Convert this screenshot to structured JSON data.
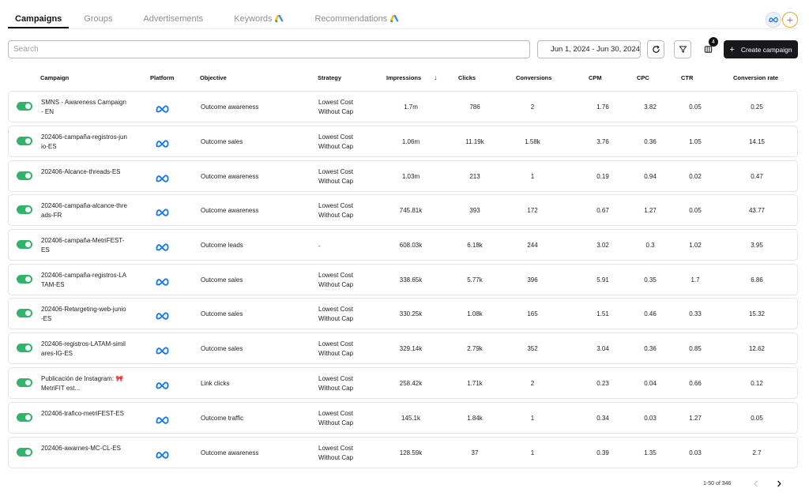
{
  "tabs": [
    {
      "label": "Campaigns",
      "active": true,
      "ads_icon": false
    },
    {
      "label": "Groups",
      "active": false,
      "ads_icon": false
    },
    {
      "label": "Advertisements",
      "active": false,
      "ads_icon": false
    },
    {
      "label": "Keywords",
      "active": false,
      "ads_icon": true
    },
    {
      "label": "Recommendations",
      "active": false,
      "ads_icon": true
    }
  ],
  "accounts": {
    "add_label": "+"
  },
  "search": {
    "placeholder": "Search",
    "value": ""
  },
  "toolbar": {
    "date_range": "Jun 1, 2024 - Jun 30, 2024",
    "columns_badge": "4",
    "create_label": "Create campaign"
  },
  "columns": {
    "campaign": "Campaign",
    "platform": "Platform",
    "objective": "Objective",
    "strategy": "Strategy",
    "impressions": "Impressions",
    "clicks": "Clicks",
    "conversions": "Conversions",
    "cpm": "CPM",
    "cpc": "CPC",
    "ctr": "CTR",
    "conversion_rate": "Conversion rate"
  },
  "rows": [
    {
      "campaign": "SMNS - Awareness Campaign - EN",
      "platform": "meta-icon",
      "objective": "Outcome awareness",
      "strategy": "Lowest Cost\nWithout Cap",
      "impressions": "1.7m",
      "clicks": "786",
      "conversions": "2",
      "cpm": "1.76",
      "cpc": "3.82",
      "ctr": "0.05",
      "conversion_rate": "0.25"
    },
    {
      "campaign": "202406-campaña-registros-junio-ES",
      "platform": "meta-icon",
      "objective": "Outcome sales",
      "strategy": "Lowest Cost\nWithout Cap",
      "impressions": "1.06m",
      "clicks": "11.19k",
      "conversions": "1.58k",
      "cpm": "3.76",
      "cpc": "0.36",
      "ctr": "1.05",
      "conversion_rate": "14.15"
    },
    {
      "campaign": "202406-Alcance-threads-ES",
      "platform": "meta-icon",
      "objective": "Outcome awareness",
      "strategy": "Lowest Cost\nWithout Cap",
      "impressions": "1.03m",
      "clicks": "213",
      "conversions": "1",
      "cpm": "0.19",
      "cpc": "0.94",
      "ctr": "0.02",
      "conversion_rate": "0.47"
    },
    {
      "campaign": "202406-campaña-alcance-threads-FR",
      "platform": "meta-icon",
      "objective": "Outcome awareness",
      "strategy": "Lowest Cost\nWithout Cap",
      "impressions": "745.81k",
      "clicks": "393",
      "conversions": "172",
      "cpm": "0.67",
      "cpc": "1.27",
      "ctr": "0.05",
      "conversion_rate": "43.77"
    },
    {
      "campaign": "202406-campaña-MetriFEST-ES",
      "platform": "meta-icon",
      "objective": "Outcome leads",
      "strategy": "-",
      "impressions": "608.03k",
      "clicks": "6.18k",
      "conversions": "244",
      "cpm": "3.02",
      "cpc": "0.3",
      "ctr": "1.02",
      "conversion_rate": "3.95"
    },
    {
      "campaign": "202406-campaña-registros-LATAM-ES",
      "platform": "meta-icon",
      "objective": "Outcome sales",
      "strategy": "Lowest Cost\nWithout Cap",
      "impressions": "338.65k",
      "clicks": "5.77k",
      "conversions": "396",
      "cpm": "5.91",
      "cpc": "0.35",
      "ctr": "1.7",
      "conversion_rate": "6.86"
    },
    {
      "campaign": "202406-Retargeting-web-junio-ES",
      "platform": "meta-icon",
      "objective": "Outcome sales",
      "strategy": "Lowest Cost\nWithout Cap",
      "impressions": "330.25k",
      "clicks": "1.08k",
      "conversions": "165",
      "cpm": "1.51",
      "cpc": "0.46",
      "ctr": "0.33",
      "conversion_rate": "15.32"
    },
    {
      "campaign": "202406-registros-LATAM-similares-IG-ES",
      "platform": "meta-icon",
      "objective": "Outcome sales",
      "strategy": "Lowest Cost\nWithout Cap",
      "impressions": "329.14k",
      "clicks": "2.79k",
      "conversions": "352",
      "cpm": "3.04",
      "cpc": "0.36",
      "ctr": "0.85",
      "conversion_rate": "12.62"
    },
    {
      "campaign": "Publicación de Instagram: 🎀 MetriFIT est...",
      "platform": "meta-icon",
      "objective": "Link clicks",
      "strategy": "Lowest Cost\nWithout Cap",
      "impressions": "258.42k",
      "clicks": "1.71k",
      "conversions": "2",
      "cpm": "0.23",
      "cpc": "0.04",
      "ctr": "0.66",
      "conversion_rate": "0.12"
    },
    {
      "campaign": "202406-trafico-metriFEST-ES",
      "platform": "meta-icon",
      "objective": "Outcome traffic",
      "strategy": "Lowest Cost\nWithout Cap",
      "impressions": "145.1k",
      "clicks": "1.84k",
      "conversions": "1",
      "cpm": "0.34",
      "cpc": "0.03",
      "ctr": "1.27",
      "conversion_rate": "0.05"
    },
    {
      "campaign": "202406-awarnes-MC-CL-ES",
      "platform": "meta-icon",
      "objective": "Outcome awareness",
      "strategy": "Lowest Cost\nWithout Cap",
      "impressions": "128.59k",
      "clicks": "37",
      "conversions": "1",
      "cpm": "0.39",
      "cpc": "1.35",
      "ctr": "0.03",
      "conversion_rate": "2.7"
    }
  ],
  "pagination": {
    "label": "1-50 of 346"
  },
  "colors": {
    "toggle_on": "#2fb46a",
    "primary_button": "#16181b",
    "meta_blue": "#1877f2"
  }
}
